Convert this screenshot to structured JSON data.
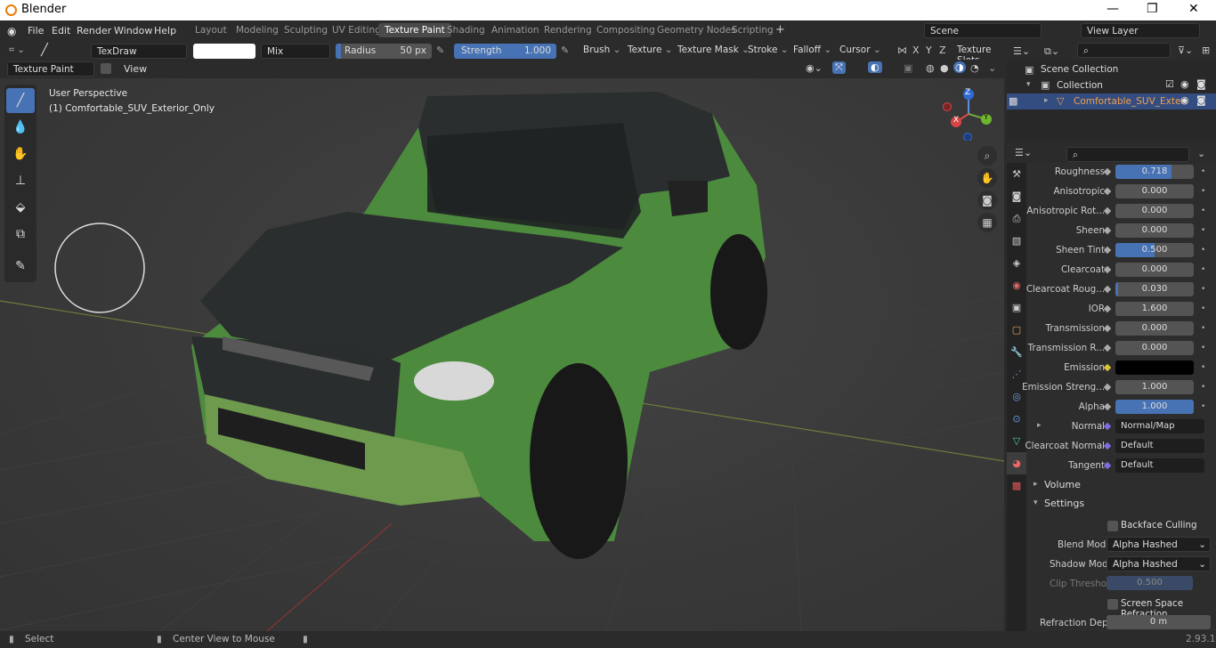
{
  "app": {
    "title": "Blender",
    "version": "2.93.1"
  },
  "menus": [
    "File",
    "Edit",
    "Render",
    "Window",
    "Help"
  ],
  "workspaces": [
    "Layout",
    "Modeling",
    "Sculpting",
    "UV Editing",
    "Texture Paint",
    "Shading",
    "Animation",
    "Rendering",
    "Compositing",
    "Geometry Nodes",
    "Scripting"
  ],
  "active_workspace": "Texture Paint",
  "scene": "Scene",
  "view_layer": "View Layer",
  "tool_header": {
    "brush": "TexDraw",
    "blend": "Mix",
    "radius_label": "Radius",
    "radius_value": "50 px",
    "strength_label": "Strength",
    "strength_value": "1.000",
    "strength_fill": 1.0,
    "menus": [
      "Brush",
      "Texture",
      "Texture Mask",
      "Stroke",
      "Falloff",
      "Cursor"
    ],
    "axes": [
      "X",
      "Y",
      "Z"
    ],
    "texture_slots": "Texture Slots"
  },
  "view_header": {
    "mode": "Texture Paint",
    "view": "View"
  },
  "viewport": {
    "perspective": "User Perspective",
    "object": "(1) Comfortable_SUV_Exterior_Only"
  },
  "gizmo": {
    "x": "X",
    "y": "Y",
    "z": "Z"
  },
  "outliner": {
    "root": "Scene Collection",
    "collection": "Collection",
    "object": "Comfortable_SUV_Exteri"
  },
  "properties": [
    {
      "label": "Roughness",
      "value": "0.718",
      "fill": 0.718
    },
    {
      "label": "Anisotropic",
      "value": "0.000",
      "fill": 0
    },
    {
      "label": "Anisotropic Rot...",
      "value": "0.000",
      "fill": 0
    },
    {
      "label": "Sheen",
      "value": "0.000",
      "fill": 0
    },
    {
      "label": "Sheen Tint",
      "value": "0.500",
      "fill": 0.5
    },
    {
      "label": "Clearcoat",
      "value": "0.000",
      "fill": 0
    },
    {
      "label": "Clearcoat Roug...",
      "value": "0.030",
      "fill": 0.03
    },
    {
      "label": "IOR",
      "value": "1.600",
      "fill": 0
    },
    {
      "label": "Transmission",
      "value": "0.000",
      "fill": 0
    },
    {
      "label": "Transmission R...",
      "value": "0.000",
      "fill": 0
    },
    {
      "label": "Emission",
      "value": "",
      "fill": 0,
      "color": "#000000"
    },
    {
      "label": "Emission Streng...",
      "value": "1.000",
      "fill": 0
    },
    {
      "label": "Alpha",
      "value": "1.000",
      "fill": 1.0
    },
    {
      "label": "Normal",
      "value": "Normal/Map",
      "fill": 0
    },
    {
      "label": "Clearcoat Normal",
      "value": "Default",
      "fill": 0
    },
    {
      "label": "Tangent",
      "value": "Default",
      "fill": 0
    }
  ],
  "sections": {
    "volume": "Volume",
    "settings": "Settings"
  },
  "settings": {
    "backface": "Backface Culling",
    "blend_mode_label": "Blend Mode",
    "blend_mode": "Alpha Hashed",
    "shadow_mode_label": "Shadow Mode",
    "shadow_mode": "Alpha Hashed",
    "clip_label": "Clip Threshold",
    "clip_value": "0.500",
    "ssr": "Screen Space Refraction",
    "depth_label": "Refraction Depth",
    "depth_value": "0 m"
  },
  "status": {
    "select": "Select",
    "center": "Center View to Mouse"
  },
  "colors": {
    "accent": "#4772b3",
    "car_body": "#4c8a3e",
    "car_roof": "#2b2e2e"
  }
}
